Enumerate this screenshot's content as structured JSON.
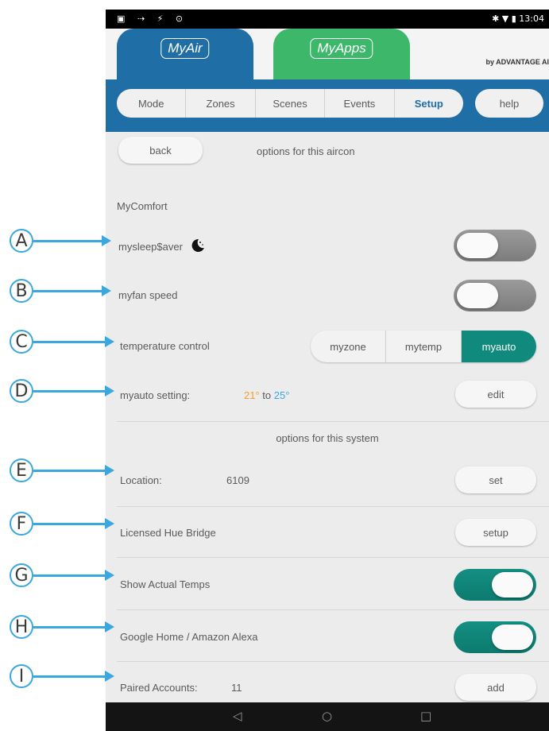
{
  "status_bar": {
    "left_icons": [
      "notification-icon",
      "usb-icon",
      "download-icon",
      "alarm-icon"
    ],
    "left_glyphs": "▣ ⇢ ⚡ ⊙",
    "right_text": "✱ ▼ ▮ 13:04",
    "time": "13:04"
  },
  "header": {
    "tab_myair": "MyAir",
    "tab_myapps": "MyApps",
    "brand": "by ADVANTAGE AI"
  },
  "nav": {
    "tabs": [
      "Mode",
      "Zones",
      "Scenes",
      "Events",
      "Setup"
    ],
    "active_tab": "Setup",
    "help": "help"
  },
  "aircon_section": {
    "back": "back",
    "title": "options for this aircon",
    "mycomfort_heading": "MyComfort",
    "mysleep_label": "mysleep$aver",
    "mysleep_on": false,
    "myfan_label": "myfan speed",
    "myfan_on": false,
    "temp_control_label": "temperature control",
    "temp_control_options": [
      "myzone",
      "mytemp",
      "myauto"
    ],
    "temp_control_selected": "myauto",
    "myauto_label": "myauto setting:",
    "myauto_low": "21°",
    "myauto_to": "to",
    "myauto_high": "25°",
    "edit": "edit",
    "color_low": "#f0a030",
    "color_high": "#3aa7df"
  },
  "system_section": {
    "title": "options for this system",
    "location_label": "Location:",
    "location_value": "6109",
    "set": "set",
    "hue_label": "Licensed Hue Bridge",
    "hue_button": "setup",
    "show_temps_label": "Show Actual Temps",
    "show_temps_on": true,
    "google_label": "Google Home / Amazon Alexa",
    "google_on": true,
    "paired_label": "Paired Accounts:",
    "paired_value": "11",
    "add": "add"
  },
  "android_nav": {
    "back": "◁",
    "home": "○",
    "recent": "□"
  },
  "callouts": [
    "A",
    "B",
    "C",
    "D",
    "E",
    "F",
    "G",
    "H",
    "I"
  ],
  "colors": {
    "primary_blue": "#1f6ea6",
    "myapps_green": "#3db86b",
    "toggle_on": "#0f8a7c",
    "callout_blue": "#3aa7df"
  }
}
